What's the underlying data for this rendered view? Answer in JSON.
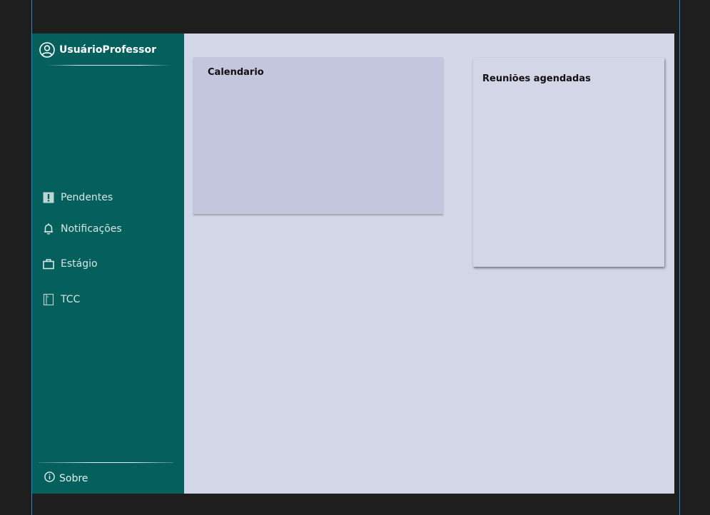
{
  "user": {
    "name": "UsuárioProfessor",
    "icon": "user-circle-icon"
  },
  "nav": [
    {
      "label": "Pendentes",
      "icon": "alert-square-icon"
    },
    {
      "label": "Notificações",
      "icon": "bell-icon"
    },
    {
      "label": "Estágio",
      "icon": "briefcase-icon"
    },
    {
      "label": "TCC",
      "icon": "book-icon"
    }
  ],
  "footer": {
    "label": "Sobre",
    "icon": "info-icon"
  },
  "cards": {
    "calendar": {
      "title": "Calendario"
    },
    "meetings": {
      "title": "Reuniões agendadas"
    }
  },
  "colors": {
    "sidebar": "#055f5d",
    "content": "#d3d6e6",
    "calendar_card": "#c3c6dc",
    "background": "#1e1e1e",
    "guide_line": "#2f86d6"
  }
}
